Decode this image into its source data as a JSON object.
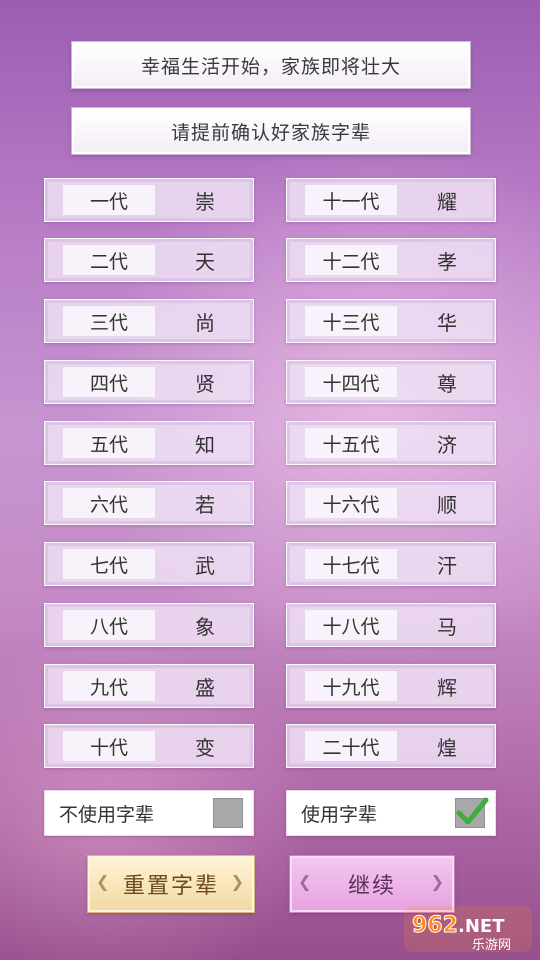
{
  "banners": {
    "line1": "幸福生活开始，家族即将壮大",
    "line2": "请提前确认好家族字辈"
  },
  "generations": [
    {
      "label": "一代",
      "char": "崇"
    },
    {
      "label": "二代",
      "char": "天"
    },
    {
      "label": "三代",
      "char": "尚"
    },
    {
      "label": "四代",
      "char": "贤"
    },
    {
      "label": "五代",
      "char": "知"
    },
    {
      "label": "六代",
      "char": "若"
    },
    {
      "label": "七代",
      "char": "武"
    },
    {
      "label": "八代",
      "char": "象"
    },
    {
      "label": "九代",
      "char": "盛"
    },
    {
      "label": "十代",
      "char": "变"
    },
    {
      "label": "十一代",
      "char": "耀"
    },
    {
      "label": "十二代",
      "char": "孝"
    },
    {
      "label": "十三代",
      "char": "华"
    },
    {
      "label": "十四代",
      "char": "尊"
    },
    {
      "label": "十五代",
      "char": "济"
    },
    {
      "label": "十六代",
      "char": "顺"
    },
    {
      "label": "十七代",
      "char": "汗"
    },
    {
      "label": "十八代",
      "char": "马"
    },
    {
      "label": "十九代",
      "char": "辉"
    },
    {
      "label": "二十代",
      "char": "煌"
    }
  ],
  "options": {
    "no_use": {
      "label": "不使用字辈",
      "checked": false
    },
    "use": {
      "label": "使用字辈",
      "checked": true
    }
  },
  "buttons": {
    "reset": "重置字辈",
    "continue": "继续"
  },
  "watermark": {
    "brand": "962.NET",
    "sub": "乐游网"
  },
  "colors": {
    "check": "#3fae3a",
    "unchecked": "#a8a8a8"
  }
}
